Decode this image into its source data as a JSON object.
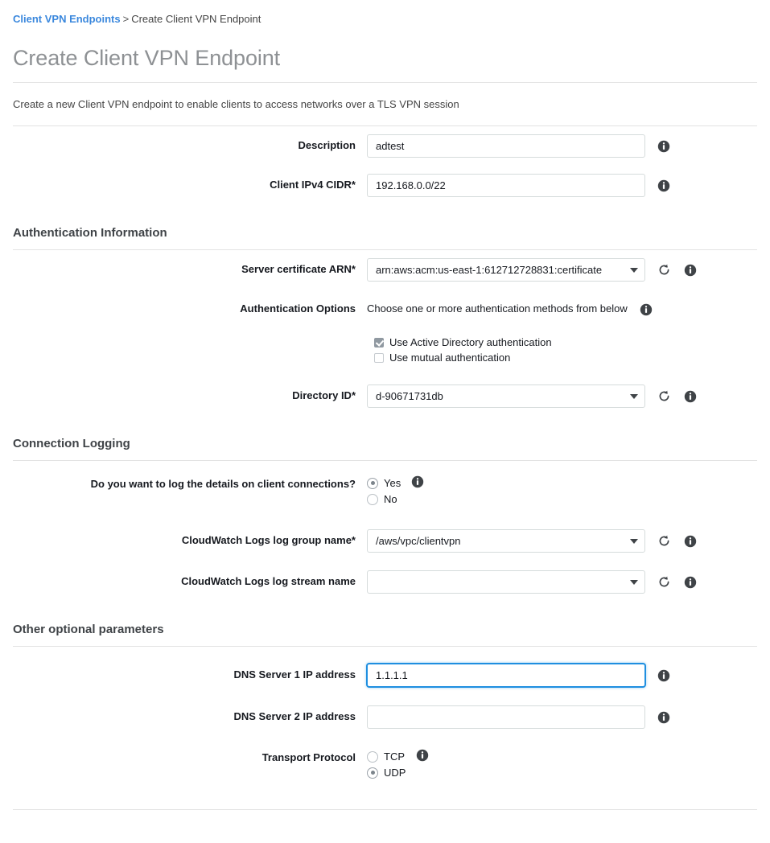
{
  "breadcrumb": {
    "link": "Client VPN Endpoints",
    "separator": ">",
    "current": "Create Client VPN Endpoint"
  },
  "page": {
    "title": "Create Client VPN Endpoint",
    "intro": "Create a new Client VPN endpoint to enable clients to access networks over a TLS VPN session"
  },
  "basic": {
    "description": {
      "label": "Description",
      "value": "adtest",
      "info_icon": "info-icon"
    },
    "cidr": {
      "label": "Client IPv4 CIDR*",
      "value": "192.168.0.0/22",
      "info_icon": "info-icon"
    }
  },
  "auth_section": {
    "heading": "Authentication Information",
    "server_cert": {
      "label": "Server certificate ARN*",
      "value": "arn:aws:acm:us-east-1:612712728831:certificate",
      "refresh_icon": "refresh-icon",
      "info_icon": "info-icon"
    },
    "auth_options": {
      "label": "Authentication Options",
      "note": "Choose one or more authentication methods from below",
      "info_icon": "info-icon",
      "options": [
        {
          "label": "Use Active Directory authentication",
          "checked": true
        },
        {
          "label": "Use mutual authentication",
          "checked": false
        }
      ]
    },
    "directory_id": {
      "label": "Directory ID*",
      "value": "d-90671731db",
      "refresh_icon": "refresh-icon",
      "info_icon": "info-icon"
    }
  },
  "logging_section": {
    "heading": "Connection Logging",
    "log_question": {
      "label": "Do you want to log the details on client connections?",
      "info_icon": "info-icon",
      "options": [
        {
          "label": "Yes",
          "selected": true
        },
        {
          "label": "No",
          "selected": false
        }
      ]
    },
    "log_group": {
      "label": "CloudWatch Logs log group name*",
      "value": "/aws/vpc/clientvpn",
      "refresh_icon": "refresh-icon",
      "info_icon": "info-icon"
    },
    "log_stream": {
      "label": "CloudWatch Logs log stream name",
      "value": "",
      "refresh_icon": "refresh-icon",
      "info_icon": "info-icon"
    }
  },
  "optional_section": {
    "heading": "Other optional parameters",
    "dns1": {
      "label": "DNS Server 1 IP address",
      "value": "1.1.1.1",
      "focused": true,
      "info_icon": "info-icon"
    },
    "dns2": {
      "label": "DNS Server 2 IP address",
      "value": "",
      "focused": false,
      "info_icon": "info-icon"
    },
    "transport": {
      "label": "Transport Protocol",
      "info_icon": "info-icon",
      "options": [
        {
          "label": "TCP",
          "selected": false
        },
        {
          "label": "UDP",
          "selected": true
        }
      ]
    }
  },
  "colors": {
    "link_blue": "#3b88dd",
    "focus_blue": "#1f8fe0",
    "title_gray": "#8e9194",
    "text_dark": "#16191f",
    "border_gray": "#d5dbdb"
  }
}
